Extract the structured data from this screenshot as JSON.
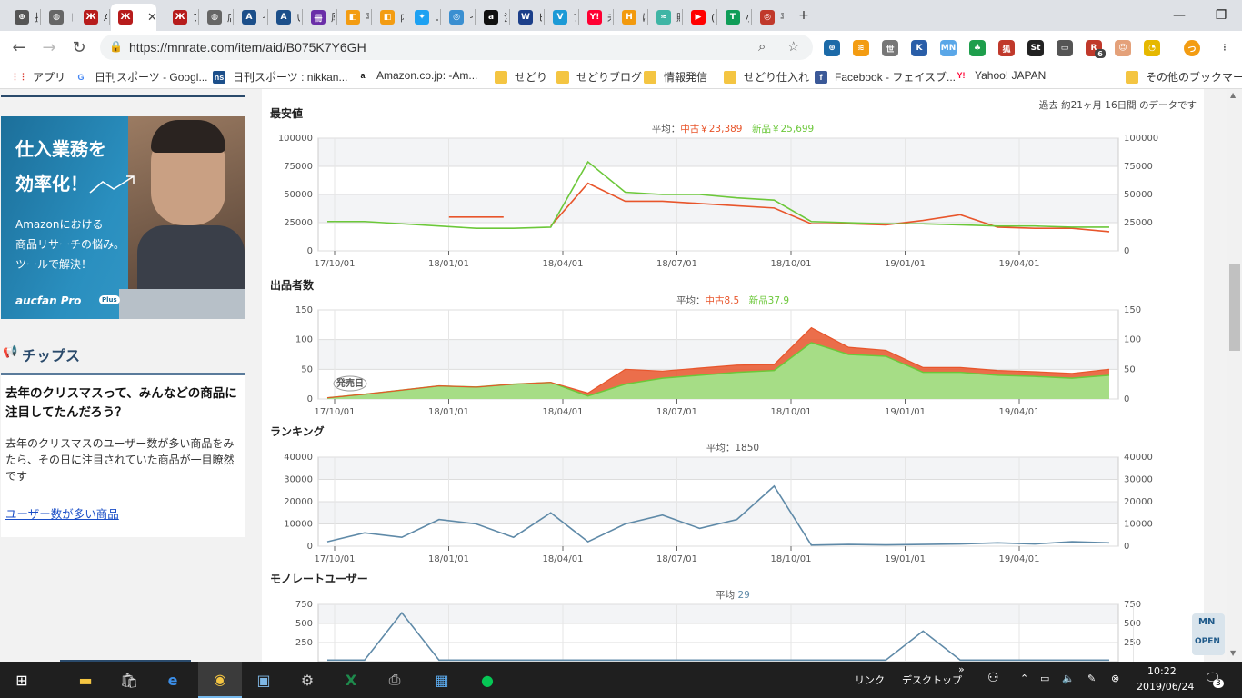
{
  "browser": {
    "tabs": [
      {
        "title": "投",
        "icon": "b-icon",
        "color": "#555"
      },
      {
        "title": "ト",
        "icon": "globe-icon",
        "color": "#666"
      },
      {
        "title": "AF",
        "icon": "keepa-icon",
        "color": "#b71c1c"
      },
      {
        "title": "",
        "icon": "keepa-icon",
        "color": "#b71c1c",
        "active": true
      },
      {
        "title": "ア",
        "icon": "keepa-icon",
        "color": "#b71c1c"
      },
      {
        "title": "店",
        "icon": "globe-icon",
        "color": "#666"
      },
      {
        "title": "イ",
        "icon": "aucfan-icon",
        "color": "#1c4f8a"
      },
      {
        "title": "い",
        "icon": "aucfan-icon",
        "color": "#1c4f8a"
      },
      {
        "title": "厚",
        "icon": "book-icon",
        "color": "#6a2ea8"
      },
      {
        "title": "平",
        "icon": "orange-icon",
        "color": "#f39c12"
      },
      {
        "title": "内",
        "icon": "orange-icon",
        "color": "#f39c12"
      },
      {
        "title": "ニ",
        "icon": "twitter-icon",
        "color": "#1da1f2"
      },
      {
        "title": "イ",
        "icon": "web-icon",
        "color": "#3a8fd1"
      },
      {
        "title": "注",
        "icon": "amazon-icon",
        "color": "#111"
      },
      {
        "title": "ビ",
        "icon": "ws-icon",
        "color": "#1c3f8a"
      },
      {
        "title": "ブ",
        "icon": "v-icon",
        "color": "#1c9ad6"
      },
      {
        "title": "未",
        "icon": "yahoo-icon",
        "color": "#ff0033"
      },
      {
        "title": "は",
        "icon": "hatena-icon",
        "color": "#f29a0e"
      },
      {
        "title": "販",
        "icon": "sw-icon",
        "color": "#3fb5a5"
      },
      {
        "title": "(1",
        "icon": "youtube-icon",
        "color": "#ff0000"
      },
      {
        "title": "小",
        "icon": "t-icon",
        "color": "#0f9d58"
      },
      {
        "title": "平",
        "icon": "target-icon",
        "color": "#c0392b"
      }
    ],
    "url": "https://mnrate.com/item/aid/B075K7Y6GH",
    "bookmarks": [
      {
        "label": "アプリ",
        "icon": "apps-icon"
      },
      {
        "label": "日刊スポーツ - Googl...",
        "icon": "google-icon"
      },
      {
        "label": "日刊スポーツ : nikkan...",
        "icon": "ns-icon"
      },
      {
        "label": "Amazon.co.jp: -Am...",
        "icon": "amazon-icon"
      },
      {
        "label": "せどり",
        "icon": "folder-icon"
      },
      {
        "label": "せどりブログ",
        "icon": "folder-icon"
      },
      {
        "label": "情報発信",
        "icon": "folder-icon"
      },
      {
        "label": "せどり仕入れ",
        "icon": "folder-icon"
      },
      {
        "label": "Facebook - フェイスブ...",
        "icon": "facebook-icon"
      },
      {
        "label": "Yahoo! JAPAN",
        "icon": "yahoo-icon"
      },
      {
        "label": "その他のブックマーク",
        "icon": "folder-icon"
      }
    ],
    "ext_badge": "6"
  },
  "sidebar": {
    "ad": {
      "line1": "仕入業務を",
      "line2": "効率化！",
      "line3": "Amazonにおける",
      "line4": "商品リサーチの悩み。",
      "line5": "ツールで解決！",
      "brand": "aucfan Pro",
      "brand_badge": "Plus"
    },
    "tips_title": "チップス",
    "tip_heading": "去年のクリスマスって、みんなどの商品に注目してたんだろう？",
    "tip_body": "去年のクリスマスのユーザー数が多い商品をみたら、その日に注目されていた商品が一目瞭然です",
    "tip_link": "ユーザー数が多い商品"
  },
  "main": {
    "period": "過去 約21ヶ月 16日間 のデータです",
    "price_title": "最安値",
    "price_avg_label": "平均：",
    "price_avg_used": "中古￥23,389",
    "price_avg_new": "新品￥25,699",
    "offers_title": "出品者数",
    "offers_avg_label": "平均：",
    "offers_avg_used": "中古8.5",
    "offers_avg_new": "新品37.9",
    "release_label": "発売日",
    "rank_title": "ランキング",
    "rank_avg": "平均：1850",
    "users_title": "モノレートユーザー",
    "users_avg_label": "平均",
    "users_avg_value": "29",
    "open_label": "OPEN"
  },
  "colors": {
    "used": "#e8552b",
    "new": "#6cc83a",
    "rank": "#5f8aa8"
  },
  "chart_data": [
    {
      "type": "line",
      "title": "最安値",
      "x_ticks": [
        "17/10/01",
        "18/01/01",
        "18/04/01",
        "18/07/01",
        "18/10/01",
        "19/01/01",
        "19/04/01"
      ],
      "ylim": [
        0,
        100000
      ],
      "y_ticks": [
        0,
        25000,
        50000,
        75000,
        100000
      ],
      "grid": true,
      "x": [
        "17/09",
        "17/10",
        "17/11",
        "17/12",
        "18/01",
        "18/02",
        "18/03",
        "18/04",
        "18/05",
        "18/06",
        "18/07",
        "18/08",
        "18/09",
        "18/10",
        "18/11",
        "18/12",
        "19/01",
        "19/02",
        "19/03",
        "19/04",
        "19/05",
        "19/06"
      ],
      "series": [
        {
          "name": "中古",
          "color": "#e8552b",
          "values": [
            null,
            null,
            null,
            null,
            30000,
            null,
            22000,
            60000,
            44000,
            44000,
            42000,
            40000,
            38000,
            24000,
            24000,
            23000,
            27000,
            32000,
            21000,
            20000,
            20000,
            17000
          ]
        },
        {
          "name": "新品",
          "color": "#6cc83a",
          "values": [
            26000,
            26000,
            24000,
            22000,
            20000,
            20000,
            21000,
            79000,
            52000,
            50000,
            50000,
            47000,
            45000,
            26000,
            25000,
            24000,
            24000,
            23000,
            22000,
            22000,
            21000,
            21000
          ]
        }
      ]
    },
    {
      "type": "area",
      "title": "出品者数",
      "x_ticks": [
        "17/10/01",
        "18/01/01",
        "18/04/01",
        "18/07/01",
        "18/10/01",
        "19/01/01",
        "19/04/01"
      ],
      "ylim": [
        0,
        150
      ],
      "y_ticks": [
        0,
        50,
        100,
        150
      ],
      "grid": true,
      "x": [
        "17/09",
        "17/10",
        "17/11",
        "17/12",
        "18/01",
        "18/02",
        "18/03",
        "18/04",
        "18/05",
        "18/06",
        "18/07",
        "18/08",
        "18/09",
        "18/10",
        "18/11",
        "18/12",
        "19/01",
        "19/02",
        "19/03",
        "19/04",
        "19/05",
        "19/06"
      ],
      "series": [
        {
          "name": "新品",
          "color": "#6cc83a",
          "values": [
            2,
            8,
            15,
            22,
            20,
            25,
            28,
            5,
            25,
            35,
            40,
            45,
            48,
            95,
            75,
            72,
            45,
            45,
            40,
            38,
            35,
            40
          ]
        },
        {
          "name": "中古",
          "color": "#e8552b",
          "values": [
            0,
            0,
            0,
            0,
            0,
            0,
            0,
            5,
            25,
            12,
            12,
            12,
            10,
            25,
            12,
            10,
            8,
            8,
            8,
            8,
            8,
            10
          ]
        }
      ]
    },
    {
      "type": "line",
      "title": "ランキング",
      "x_ticks": [
        "17/10/01",
        "18/01/01",
        "18/04/01",
        "18/07/01",
        "18/10/01",
        "19/01/01",
        "19/04/01"
      ],
      "ylim": [
        0,
        40000
      ],
      "y_ticks": [
        0,
        10000,
        20000,
        30000,
        40000
      ],
      "grid": true,
      "x": [
        "17/09",
        "17/10",
        "17/11",
        "17/12",
        "18/01",
        "18/02",
        "18/03",
        "18/04",
        "18/05",
        "18/06",
        "18/07",
        "18/08",
        "18/09",
        "18/10",
        "18/11",
        "18/12",
        "19/01",
        "19/02",
        "19/03",
        "19/04",
        "19/05",
        "19/06"
      ],
      "series": [
        {
          "name": "ランキング",
          "color": "#5f8aa8",
          "values": [
            2000,
            6000,
            4000,
            12000,
            10000,
            4000,
            15000,
            2000,
            10000,
            14000,
            8000,
            12000,
            27000,
            500,
            800,
            600,
            800,
            1000,
            1500,
            1000,
            2000,
            1500
          ]
        }
      ]
    },
    {
      "type": "line",
      "title": "モノレートユーザー",
      "ylim": [
        0,
        750
      ],
      "y_ticks": [
        250,
        500,
        750
      ],
      "grid": true,
      "series": [
        {
          "name": "モノレートユーザー",
          "color": "#5f8aa8",
          "values": [
            20,
            20,
            640,
            20,
            20,
            20,
            20,
            20,
            20,
            20,
            20,
            20,
            20,
            20,
            20,
            20,
            400,
            20,
            20,
            20,
            20,
            20
          ]
        }
      ]
    }
  ],
  "taskbar": {
    "link_label": "リンク",
    "desktop_label": "デスクトップ",
    "time": "10:22",
    "date": "2019/06/24",
    "notif_count": "3"
  }
}
